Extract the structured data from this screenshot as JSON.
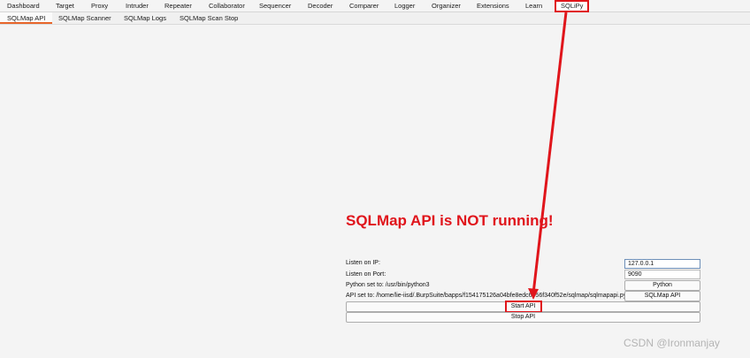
{
  "main_tabs": [
    "Dashboard",
    "Target",
    "Proxy",
    "Intruder",
    "Repeater",
    "Collaborator",
    "Sequencer",
    "Decoder",
    "Comparer",
    "Logger",
    "Organizer",
    "Extensions",
    "Learn",
    "SQLiPy"
  ],
  "sub_tabs": [
    "SQLMap API",
    "SQLMap Scanner",
    "SQLMap Logs",
    "SQLMap Scan Stop"
  ],
  "status_text": "SQLMap API is NOT running!",
  "form": {
    "listen_ip_label": "Listen on IP:",
    "listen_ip_value": "127.0.0.1",
    "listen_port_label": "Listen on Port:",
    "listen_port_value": "9090",
    "python_label": "Python set to: /usr/bin/python3",
    "python_button": "Python",
    "api_label": "API set to: /home/lie-iisd/.BurpSuite/bapps/f154175126a04bfe8edc6656f340f52e/sqlmap/sqlmapapi.py",
    "api_button": "SQLMap API",
    "start_button": "Start API",
    "stop_button": "Stop API"
  },
  "watermark": "CSDN @Ironmanjay",
  "colors": {
    "highlight": "#e0151b",
    "status": "#e0141b",
    "active_subtab": "#e8662b"
  }
}
